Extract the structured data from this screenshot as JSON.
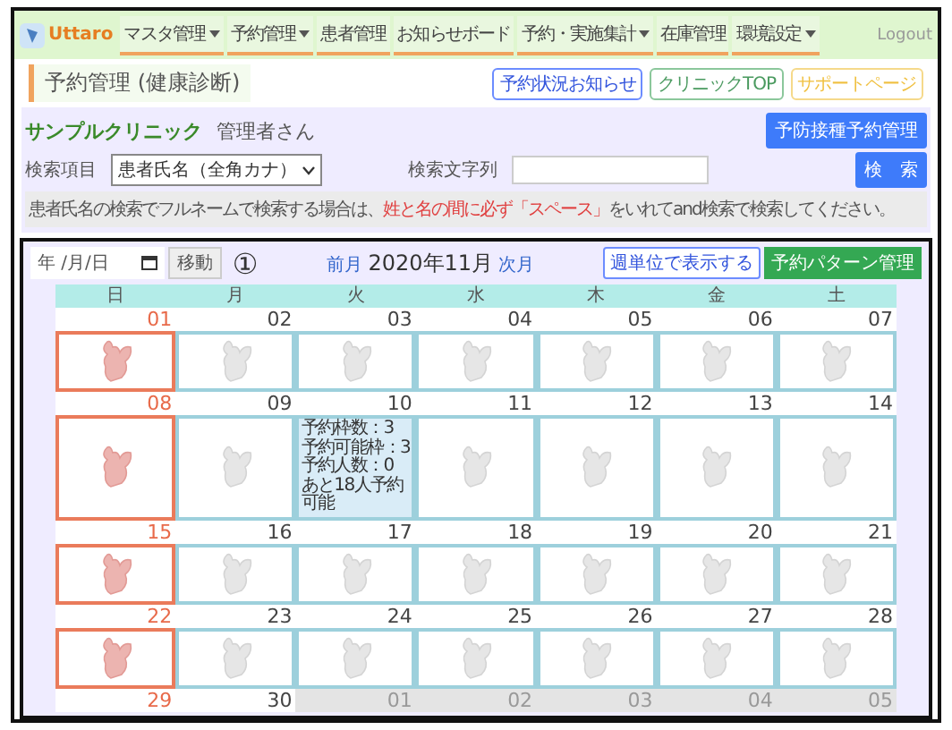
{
  "nav": {
    "brand": "Uttaro",
    "items": [
      {
        "label": "マスタ管理",
        "dropdown": true
      },
      {
        "label": "予約管理",
        "dropdown": true
      },
      {
        "label": "患者管理",
        "dropdown": false
      },
      {
        "label": "お知らせボード",
        "dropdown": false
      },
      {
        "label": "予約・実施集計",
        "dropdown": true
      },
      {
        "label": "在庫管理",
        "dropdown": false
      },
      {
        "label": "環境設定",
        "dropdown": true
      }
    ],
    "logout": "Logout"
  },
  "page_title": "予約管理 (健康診断)",
  "header_buttons": [
    {
      "label": "予約状況お知らせ",
      "kind": "blue"
    },
    {
      "label": "クリニックTOP",
      "kind": "green"
    },
    {
      "label": "サポートページ",
      "kind": "yellow"
    }
  ],
  "clinic": {
    "name": "サンプルクリニック",
    "user": "管理者さん",
    "button": "予防接種予約管理"
  },
  "search": {
    "item_label": "検索項目",
    "select_value": "患者氏名（全角カナ）",
    "text_label": "検索文字列",
    "button": "検　索"
  },
  "note": {
    "before": "患者氏名の検索でフルネームで検索する場合は、",
    "highlight": "姓と名の間に必ず「スペース」",
    "after": "をいれてand検索で検索してください。"
  },
  "calendar": {
    "date_placeholder": "年 /月/日",
    "move_button": "移動",
    "marker": "①",
    "prev": "前月",
    "month": "2020年11月",
    "next": "次月",
    "week_button": "週単位で表示する",
    "pattern_button": "予約パターン管理",
    "weekdays": [
      "日",
      "月",
      "火",
      "水",
      "木",
      "金",
      "土"
    ],
    "weeks": [
      {
        "days": [
          {
            "number": "01",
            "kind": "sun"
          },
          {
            "number": "02",
            "kind": "day"
          },
          {
            "number": "03",
            "kind": "day"
          },
          {
            "number": "04",
            "kind": "day"
          },
          {
            "number": "05",
            "kind": "day"
          },
          {
            "number": "06",
            "kind": "day"
          },
          {
            "number": "07",
            "kind": "day"
          }
        ]
      },
      {
        "days": [
          {
            "number": "08",
            "kind": "sun"
          },
          {
            "number": "09",
            "kind": "day"
          },
          {
            "number": "10",
            "kind": "booked",
            "info": [
              "予約枠数：3",
              "予約可能枠：3",
              "予約人数：0",
              "あと18人予約可能"
            ]
          },
          {
            "number": "11",
            "kind": "day"
          },
          {
            "number": "12",
            "kind": "day"
          },
          {
            "number": "13",
            "kind": "day"
          },
          {
            "number": "14",
            "kind": "day"
          }
        ]
      },
      {
        "days": [
          {
            "number": "15",
            "kind": "sun"
          },
          {
            "number": "16",
            "kind": "day"
          },
          {
            "number": "17",
            "kind": "day"
          },
          {
            "number": "18",
            "kind": "day"
          },
          {
            "number": "19",
            "kind": "day"
          },
          {
            "number": "20",
            "kind": "day"
          },
          {
            "number": "21",
            "kind": "day"
          }
        ]
      },
      {
        "days": [
          {
            "number": "22",
            "kind": "sun"
          },
          {
            "number": "23",
            "kind": "day"
          },
          {
            "number": "24",
            "kind": "day"
          },
          {
            "number": "25",
            "kind": "day"
          },
          {
            "number": "26",
            "kind": "day"
          },
          {
            "number": "27",
            "kind": "day"
          },
          {
            "number": "28",
            "kind": "day"
          }
        ]
      },
      {
        "days": [
          {
            "number": "29",
            "kind": "sun"
          },
          {
            "number": "30",
            "kind": "day"
          },
          {
            "number": "01",
            "kind": "other"
          },
          {
            "number": "02",
            "kind": "other"
          },
          {
            "number": "03",
            "kind": "other"
          },
          {
            "number": "04",
            "kind": "other"
          },
          {
            "number": "05",
            "kind": "other"
          }
        ],
        "cut": true
      }
    ]
  }
}
